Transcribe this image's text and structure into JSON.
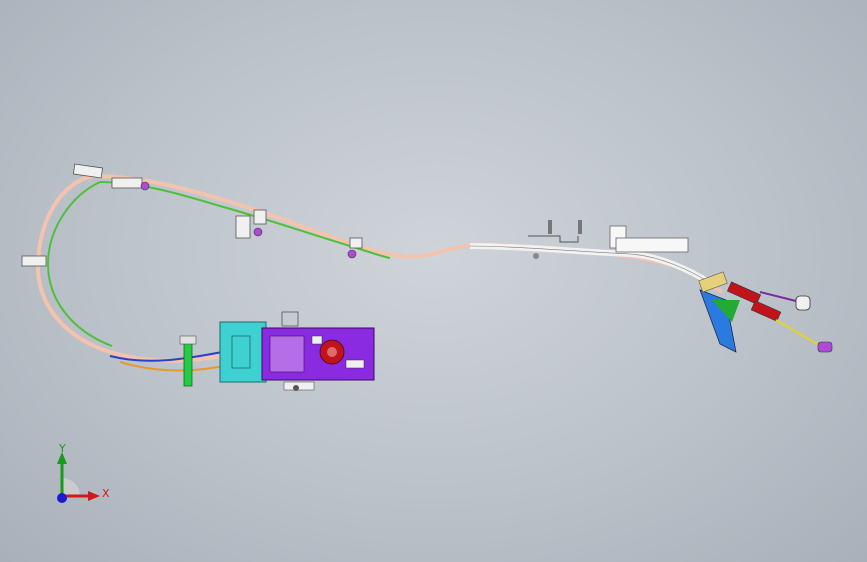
{
  "viewport": {
    "background_top": "#cfd4da",
    "background_bottom": "#a9b0b9"
  },
  "model": {
    "description_icon": "cable-assembly-model",
    "colors": {
      "cable_outer": "#f4c3ad",
      "cable_inner": "#4fbf3a",
      "cable_white": "#f2f2f2",
      "mechanism_purple": "#8a2be2",
      "mechanism_cyan": "#3fd1d1",
      "wire_blue": "#2a3fd0",
      "wire_orange": "#e79a2a",
      "bracket_blue": "#2a7be0",
      "handle_red": "#c0141a",
      "handle_green": "#22aa33"
    }
  },
  "triad": {
    "x_label": "X",
    "y_label": "Y",
    "x_color": "#d01a1a",
    "y_color": "#1a9a1a",
    "z_color": "#1a1ad0"
  }
}
